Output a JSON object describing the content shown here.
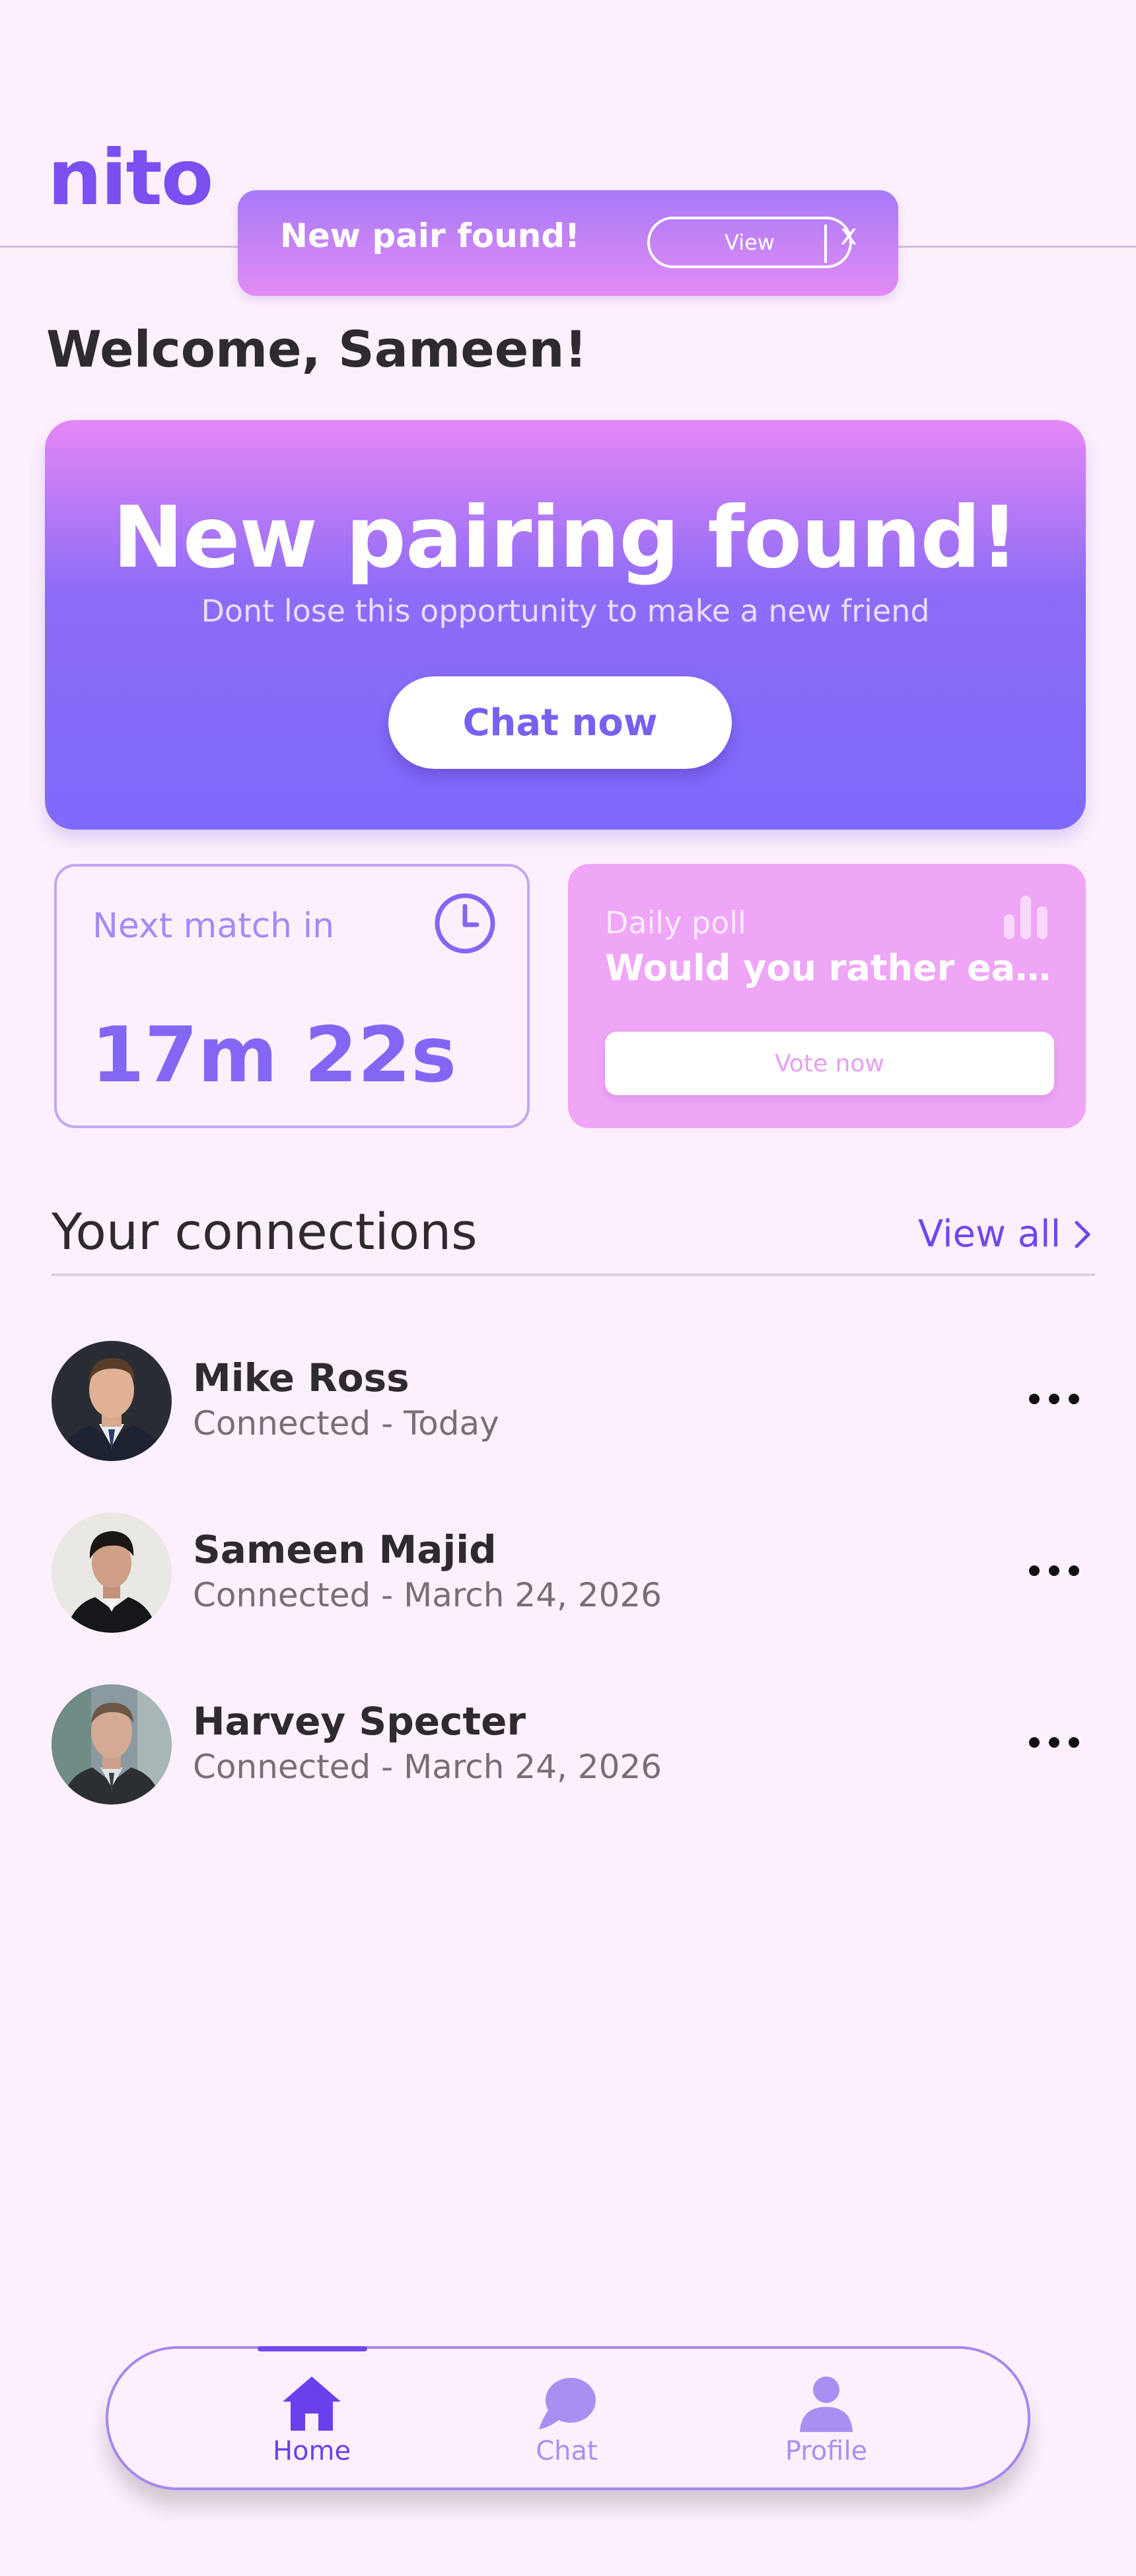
{
  "header": {
    "logo_text": "nito"
  },
  "toast": {
    "title": "New pair found!",
    "view_label": "View",
    "close_label": "x"
  },
  "welcome": "Welcome, Sameen!",
  "hero": {
    "title": "New pairing found!",
    "subtitle": "Dont lose this opportunity to make a new friend",
    "button_label": "Chat now"
  },
  "next_match": {
    "label": "Next match in",
    "time": "17m 22s",
    "icon": "clock-icon"
  },
  "poll": {
    "label": "Daily poll",
    "question": "Would you rather eat at...",
    "button_label": "Vote now",
    "icon": "bar-chart-icon"
  },
  "connections": {
    "title": "Your connections",
    "view_all": "View all",
    "items": [
      {
        "name": "Mike Ross",
        "status": "Connected - Today"
      },
      {
        "name": "Sameen Majid",
        "status": "Connected - March 24, 2026"
      },
      {
        "name": "Harvey Specter",
        "status": "Connected - March 24, 2026"
      }
    ]
  },
  "nav": {
    "items": [
      {
        "label": "Home",
        "icon": "home-icon",
        "active": true
      },
      {
        "label": "Chat",
        "icon": "chat-bubble-icon",
        "active": false
      },
      {
        "label": "Profile",
        "icon": "profile-icon",
        "active": false
      }
    ]
  },
  "colors": {
    "accent": "#7048ee",
    "background": "#fcf0fc",
    "hero_gradient_top": "#e587f6",
    "hero_gradient_bottom": "#7f69fc",
    "poll_card": "#efa6f6"
  }
}
